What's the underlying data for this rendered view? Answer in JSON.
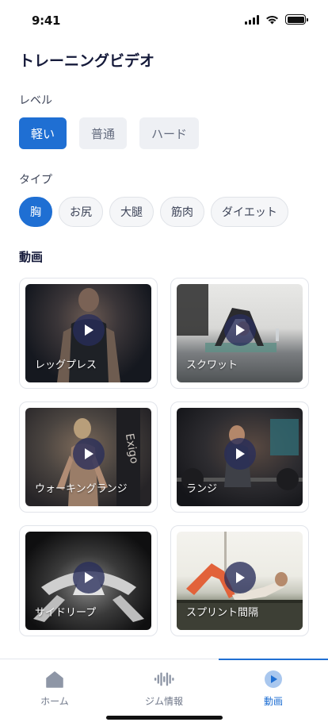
{
  "status_bar": {
    "time": "9:41"
  },
  "page": {
    "title": "トレーニングビデオ"
  },
  "level": {
    "label": "レベル",
    "options": [
      {
        "label": "軽い",
        "selected": true
      },
      {
        "label": "普通",
        "selected": false
      },
      {
        "label": "ハード",
        "selected": false
      }
    ]
  },
  "type": {
    "label": "タイプ",
    "options": [
      {
        "label": "胸",
        "selected": true
      },
      {
        "label": "お尻",
        "selected": false
      },
      {
        "label": "大腿",
        "selected": false
      },
      {
        "label": "筋肉",
        "selected": false
      },
      {
        "label": "ダイエット",
        "selected": false
      }
    ]
  },
  "videos": {
    "heading": "動画",
    "items": [
      {
        "title": "レッグプレス"
      },
      {
        "title": "スクワット"
      },
      {
        "title": "ウォーキングランジ"
      },
      {
        "title": "ランジ"
      },
      {
        "title": "サイドリープ"
      },
      {
        "title": "スプリント間隔"
      }
    ]
  },
  "tab_bar": {
    "tabs": [
      {
        "label": "ホーム",
        "icon": "home-icon",
        "active": false
      },
      {
        "label": "ジム情報",
        "icon": "gym-info-icon",
        "active": false
      },
      {
        "label": "動画",
        "icon": "video-icon",
        "active": true
      }
    ]
  },
  "colors": {
    "accent": "#1f6fd3",
    "chip_bg": "#eef0f4",
    "title": "#151a3a"
  }
}
